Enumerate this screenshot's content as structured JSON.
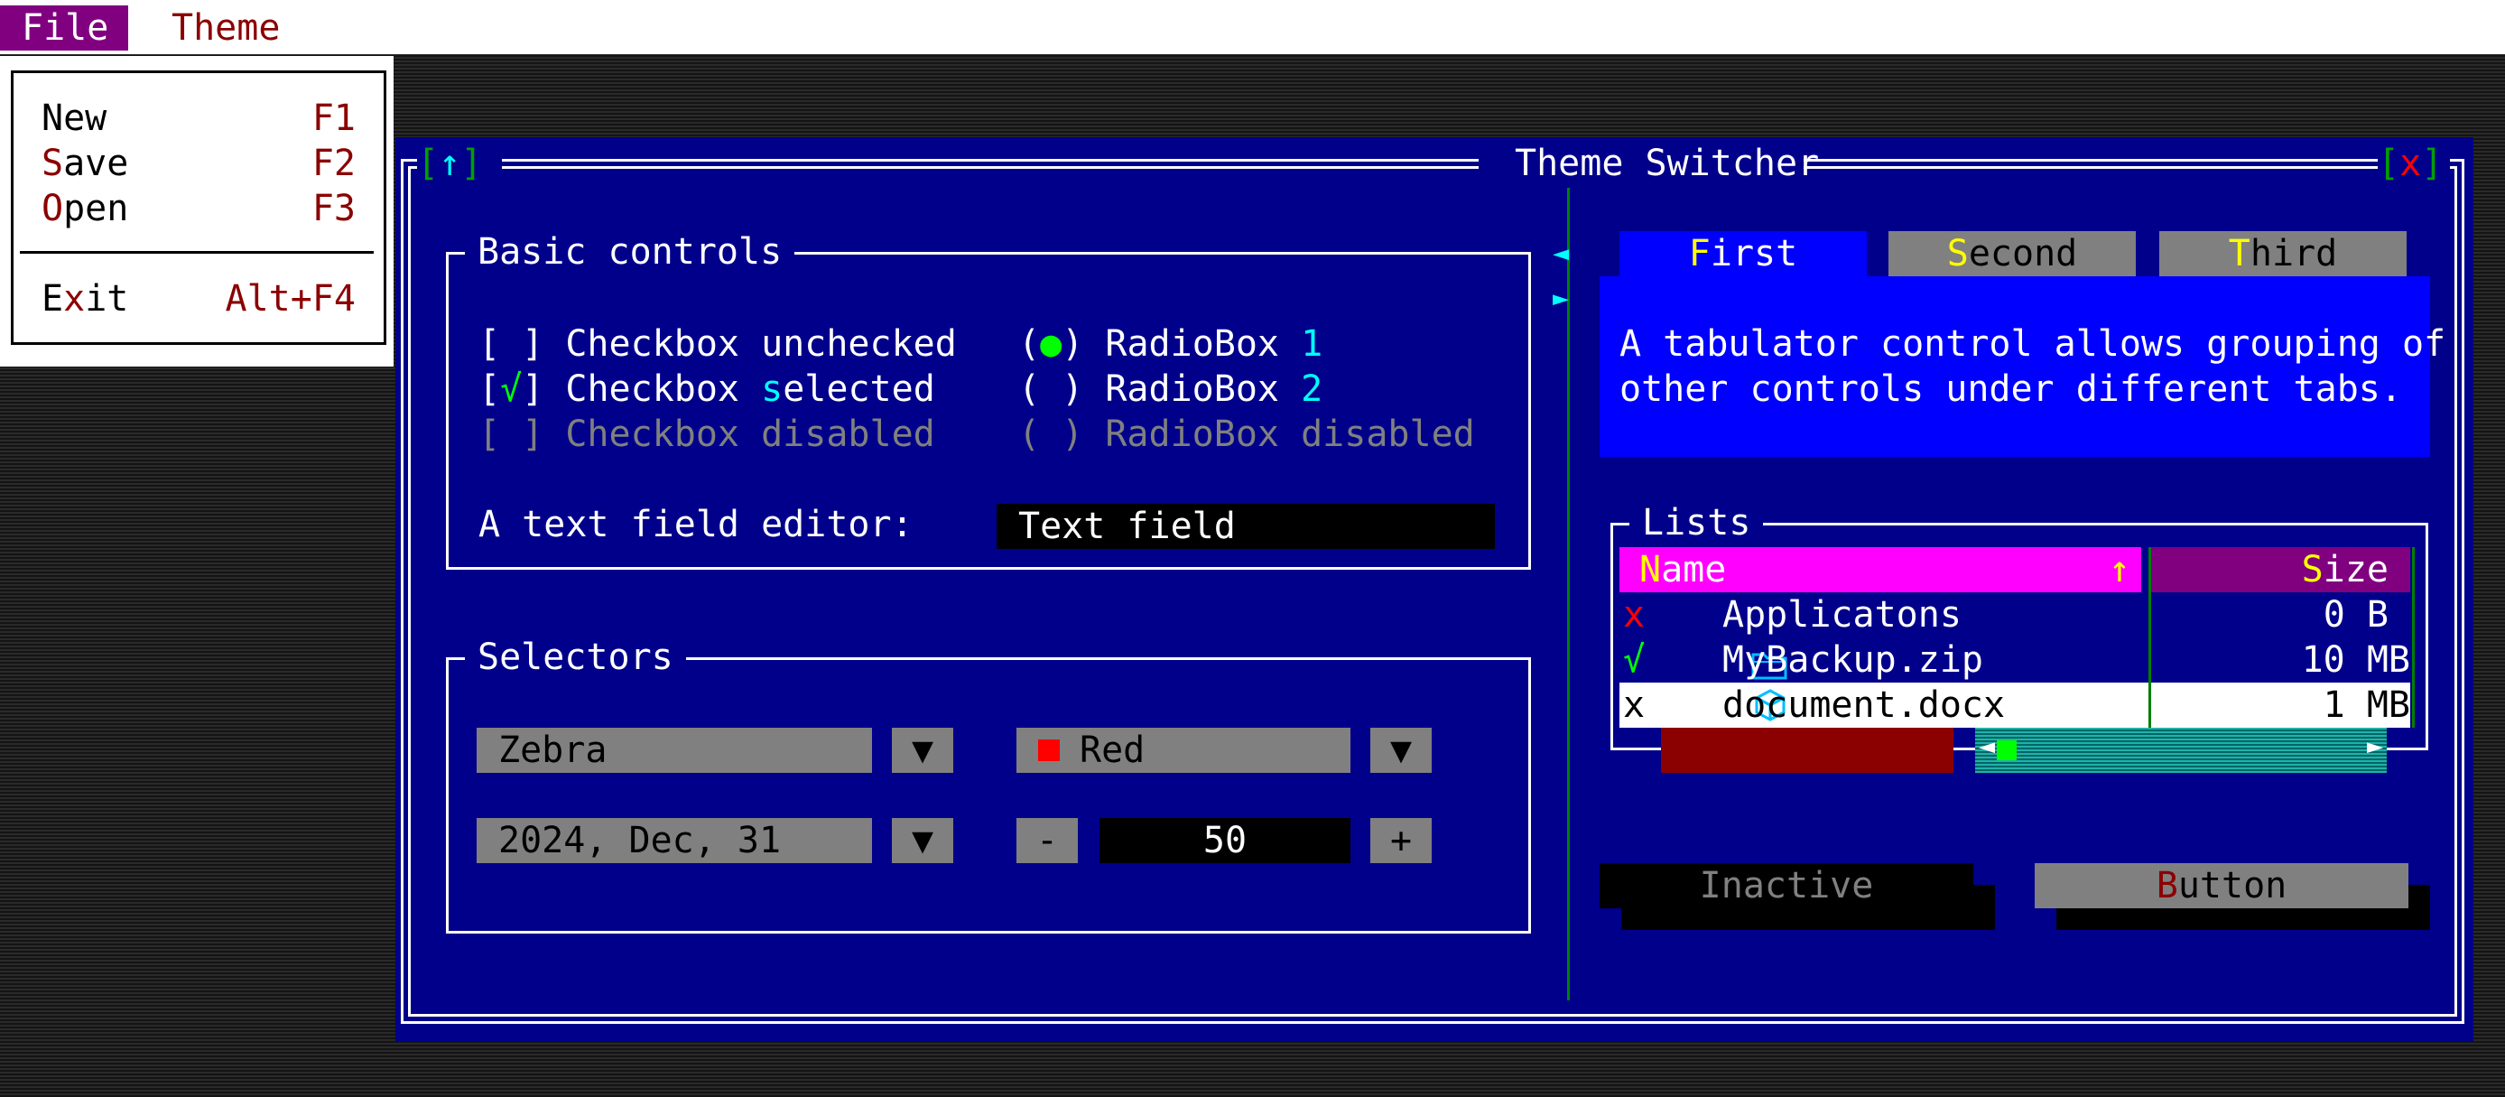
{
  "menubar": {
    "file": "File",
    "theme": "Theme"
  },
  "file_menu": {
    "items": [
      {
        "hot": "N",
        "rest": "ew",
        "shortcut": "F1"
      },
      {
        "hot": "S",
        "rest": "ave",
        "shortcut": "F2"
      },
      {
        "hot": "O",
        "rest": "pen",
        "shortcut": "F3"
      },
      {
        "pre": "E",
        "hot": "x",
        "rest": "it",
        "shortcut": "Alt+F4"
      }
    ]
  },
  "window": {
    "title": "Theme Switcher",
    "up_icon": "↑",
    "close_icon": "x"
  },
  "basic_controls": {
    "title": "Basic controls",
    "checkbox_unchecked": {
      "mark": "[ ]",
      "label": "Checkbox unchecked"
    },
    "checkbox_selected": {
      "mark": "√",
      "label_pre": "Checkbox ",
      "label_hot": "s",
      "label_post": "elected"
    },
    "checkbox_disabled": {
      "mark": "[ ]",
      "label": "Checkbox disabled"
    },
    "radio1": {
      "mark": "●",
      "label": "RadioBox ",
      "num": "1"
    },
    "radio2": {
      "mark": "( )",
      "label": "RadioBox ",
      "num": "2"
    },
    "radio_disabled": {
      "mark": "( )",
      "label": "RadioBox disabled"
    },
    "text_label": "A text field editor:",
    "text_value": "Text field"
  },
  "selectors": {
    "title": "Selectors",
    "animal": "Zebra",
    "color": "Red",
    "date": "2024, Dec, 31",
    "stepper_value": "50",
    "minus": "-",
    "plus": "+",
    "arrow": "▼"
  },
  "tabs": {
    "first": {
      "hot": "F",
      "rest": "irst"
    },
    "second": {
      "hot": "S",
      "rest": "econd"
    },
    "third": {
      "hot": "T",
      "rest": "hird"
    },
    "content_line1": "A tabulator control allows grouping of",
    "content_line2": "other controls under different tabs.",
    "left_arrow": "◄",
    "right_arrow": "►"
  },
  "lists": {
    "title": "Lists",
    "header_name": {
      "hot": "N",
      "rest": "ame"
    },
    "header_size": {
      "hot": "S",
      "rest": "ize"
    },
    "sort_icon": "↑",
    "rows": [
      {
        "status": "x",
        "name": "Applicatons",
        "size": "0 B"
      },
      {
        "status": "√",
        "name": "MyBackup.zip",
        "size": "10 MB"
      },
      {
        "status": "x",
        "name": "document.docx",
        "size": "1 MB"
      }
    ]
  },
  "buttons": {
    "inactive": "Inactive",
    "button": {
      "hot": "B",
      "rest": "utton"
    }
  },
  "colors": {
    "window_bg": "#00008b",
    "menu_highlight": "#800080",
    "tab_active": "#0000ff",
    "list_header": "#ff00ff"
  }
}
